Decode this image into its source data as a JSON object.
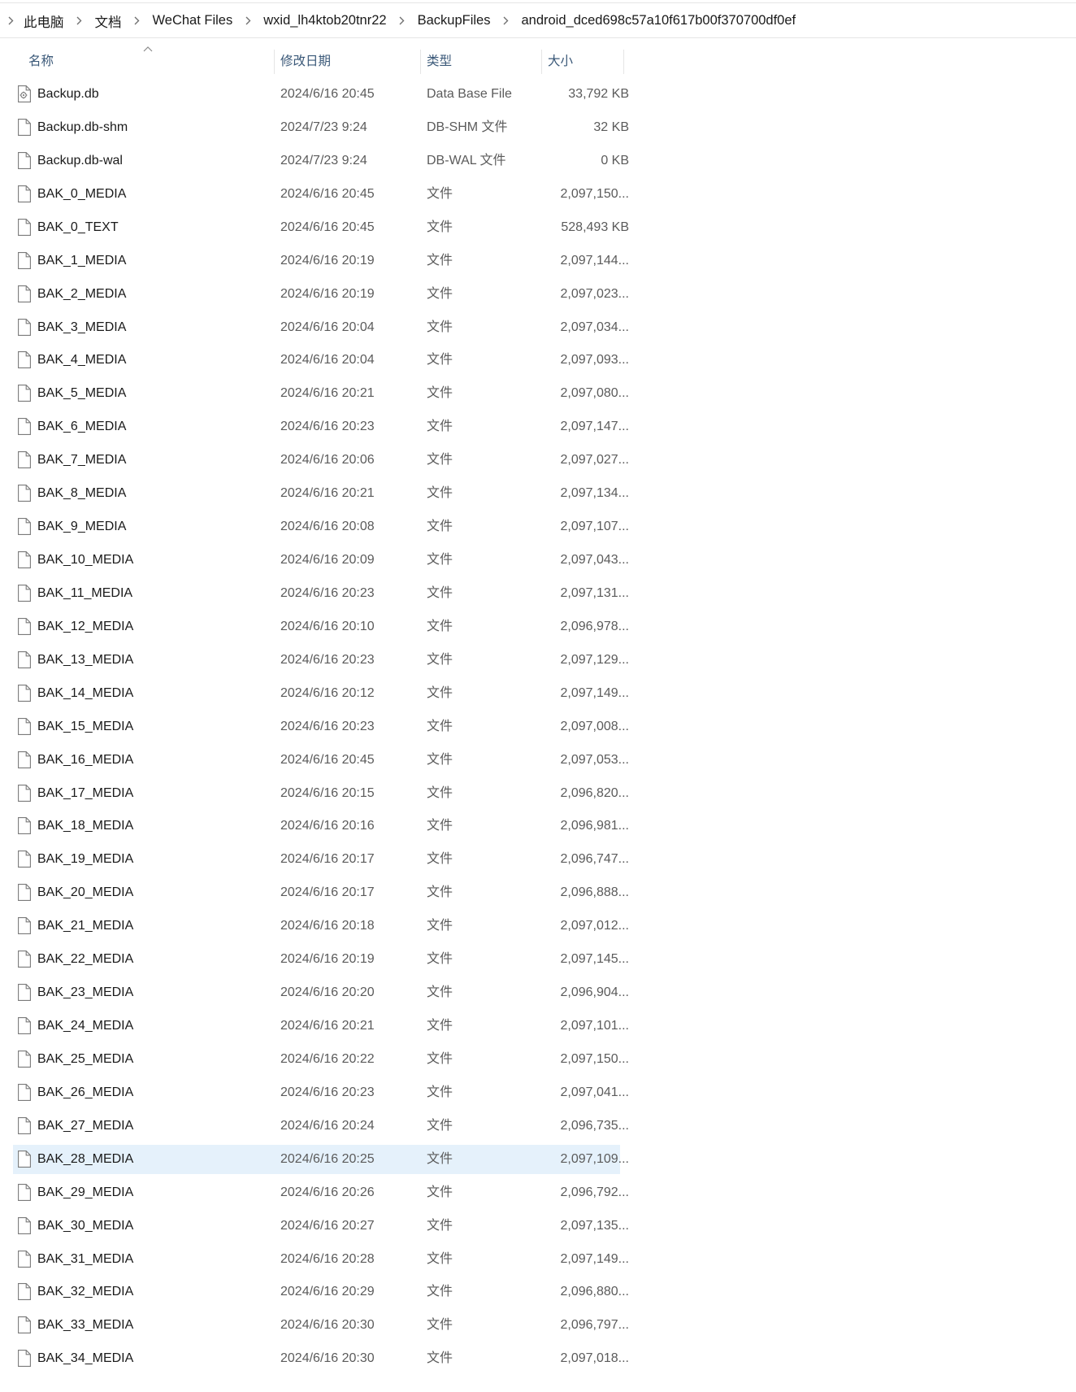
{
  "breadcrumb": {
    "items": [
      "此电脑",
      "文档",
      "WeChat Files",
      "wxid_lh4ktob20tnr22",
      "BackupFiles",
      "android_dced698c57a10f617b00f370700df0ef"
    ]
  },
  "columns": {
    "name": "名称",
    "date": "修改日期",
    "type": "类型",
    "size": "大小"
  },
  "selected_file": "BAK_28_MEDIA",
  "files": [
    {
      "name": "Backup.db",
      "date": "2024/6/16 20:45",
      "type": "Data Base File",
      "size": "33,792 KB",
      "icon": "database-file-icon"
    },
    {
      "name": "Backup.db-shm",
      "date": "2024/7/23 9:24",
      "type": "DB-SHM 文件",
      "size": "32 KB",
      "icon": "file-icon"
    },
    {
      "name": "Backup.db-wal",
      "date": "2024/7/23 9:24",
      "type": "DB-WAL 文件",
      "size": "0 KB",
      "icon": "file-icon"
    },
    {
      "name": "BAK_0_MEDIA",
      "date": "2024/6/16 20:45",
      "type": "文件",
      "size": "2,097,150...",
      "icon": "file-icon"
    },
    {
      "name": "BAK_0_TEXT",
      "date": "2024/6/16 20:45",
      "type": "文件",
      "size": "528,493 KB",
      "icon": "file-icon"
    },
    {
      "name": "BAK_1_MEDIA",
      "date": "2024/6/16 20:19",
      "type": "文件",
      "size": "2,097,144...",
      "icon": "file-icon"
    },
    {
      "name": "BAK_2_MEDIA",
      "date": "2024/6/16 20:19",
      "type": "文件",
      "size": "2,097,023...",
      "icon": "file-icon"
    },
    {
      "name": "BAK_3_MEDIA",
      "date": "2024/6/16 20:04",
      "type": "文件",
      "size": "2,097,034...",
      "icon": "file-icon"
    },
    {
      "name": "BAK_4_MEDIA",
      "date": "2024/6/16 20:04",
      "type": "文件",
      "size": "2,097,093...",
      "icon": "file-icon"
    },
    {
      "name": "BAK_5_MEDIA",
      "date": "2024/6/16 20:21",
      "type": "文件",
      "size": "2,097,080...",
      "icon": "file-icon"
    },
    {
      "name": "BAK_6_MEDIA",
      "date": "2024/6/16 20:23",
      "type": "文件",
      "size": "2,097,147...",
      "icon": "file-icon"
    },
    {
      "name": "BAK_7_MEDIA",
      "date": "2024/6/16 20:06",
      "type": "文件",
      "size": "2,097,027...",
      "icon": "file-icon"
    },
    {
      "name": "BAK_8_MEDIA",
      "date": "2024/6/16 20:21",
      "type": "文件",
      "size": "2,097,134...",
      "icon": "file-icon"
    },
    {
      "name": "BAK_9_MEDIA",
      "date": "2024/6/16 20:08",
      "type": "文件",
      "size": "2,097,107...",
      "icon": "file-icon"
    },
    {
      "name": "BAK_10_MEDIA",
      "date": "2024/6/16 20:09",
      "type": "文件",
      "size": "2,097,043...",
      "icon": "file-icon"
    },
    {
      "name": "BAK_11_MEDIA",
      "date": "2024/6/16 20:23",
      "type": "文件",
      "size": "2,097,131...",
      "icon": "file-icon"
    },
    {
      "name": "BAK_12_MEDIA",
      "date": "2024/6/16 20:10",
      "type": "文件",
      "size": "2,096,978...",
      "icon": "file-icon"
    },
    {
      "name": "BAK_13_MEDIA",
      "date": "2024/6/16 20:23",
      "type": "文件",
      "size": "2,097,129...",
      "icon": "file-icon"
    },
    {
      "name": "BAK_14_MEDIA",
      "date": "2024/6/16 20:12",
      "type": "文件",
      "size": "2,097,149...",
      "icon": "file-icon"
    },
    {
      "name": "BAK_15_MEDIA",
      "date": "2024/6/16 20:23",
      "type": "文件",
      "size": "2,097,008...",
      "icon": "file-icon"
    },
    {
      "name": "BAK_16_MEDIA",
      "date": "2024/6/16 20:45",
      "type": "文件",
      "size": "2,097,053...",
      "icon": "file-icon"
    },
    {
      "name": "BAK_17_MEDIA",
      "date": "2024/6/16 20:15",
      "type": "文件",
      "size": "2,096,820...",
      "icon": "file-icon"
    },
    {
      "name": "BAK_18_MEDIA",
      "date": "2024/6/16 20:16",
      "type": "文件",
      "size": "2,096,981...",
      "icon": "file-icon"
    },
    {
      "name": "BAK_19_MEDIA",
      "date": "2024/6/16 20:17",
      "type": "文件",
      "size": "2,096,747...",
      "icon": "file-icon"
    },
    {
      "name": "BAK_20_MEDIA",
      "date": "2024/6/16 20:17",
      "type": "文件",
      "size": "2,096,888...",
      "icon": "file-icon"
    },
    {
      "name": "BAK_21_MEDIA",
      "date": "2024/6/16 20:18",
      "type": "文件",
      "size": "2,097,012...",
      "icon": "file-icon"
    },
    {
      "name": "BAK_22_MEDIA",
      "date": "2024/6/16 20:19",
      "type": "文件",
      "size": "2,097,145...",
      "icon": "file-icon"
    },
    {
      "name": "BAK_23_MEDIA",
      "date": "2024/6/16 20:20",
      "type": "文件",
      "size": "2,096,904...",
      "icon": "file-icon"
    },
    {
      "name": "BAK_24_MEDIA",
      "date": "2024/6/16 20:21",
      "type": "文件",
      "size": "2,097,101...",
      "icon": "file-icon"
    },
    {
      "name": "BAK_25_MEDIA",
      "date": "2024/6/16 20:22",
      "type": "文件",
      "size": "2,097,150...",
      "icon": "file-icon"
    },
    {
      "name": "BAK_26_MEDIA",
      "date": "2024/6/16 20:23",
      "type": "文件",
      "size": "2,097,041...",
      "icon": "file-icon"
    },
    {
      "name": "BAK_27_MEDIA",
      "date": "2024/6/16 20:24",
      "type": "文件",
      "size": "2,096,735...",
      "icon": "file-icon"
    },
    {
      "name": "BAK_28_MEDIA",
      "date": "2024/6/16 20:25",
      "type": "文件",
      "size": "2,097,109...",
      "icon": "file-icon"
    },
    {
      "name": "BAK_29_MEDIA",
      "date": "2024/6/16 20:26",
      "type": "文件",
      "size": "2,096,792...",
      "icon": "file-icon"
    },
    {
      "name": "BAK_30_MEDIA",
      "date": "2024/6/16 20:27",
      "type": "文件",
      "size": "2,097,135...",
      "icon": "file-icon"
    },
    {
      "name": "BAK_31_MEDIA",
      "date": "2024/6/16 20:28",
      "type": "文件",
      "size": "2,097,149...",
      "icon": "file-icon"
    },
    {
      "name": "BAK_32_MEDIA",
      "date": "2024/6/16 20:29",
      "type": "文件",
      "size": "2,096,880...",
      "icon": "file-icon"
    },
    {
      "name": "BAK_33_MEDIA",
      "date": "2024/6/16 20:30",
      "type": "文件",
      "size": "2,096,797...",
      "icon": "file-icon"
    },
    {
      "name": "BAK_34_MEDIA",
      "date": "2024/6/16 20:30",
      "type": "文件",
      "size": "2,097,018...",
      "icon": "file-icon"
    }
  ]
}
